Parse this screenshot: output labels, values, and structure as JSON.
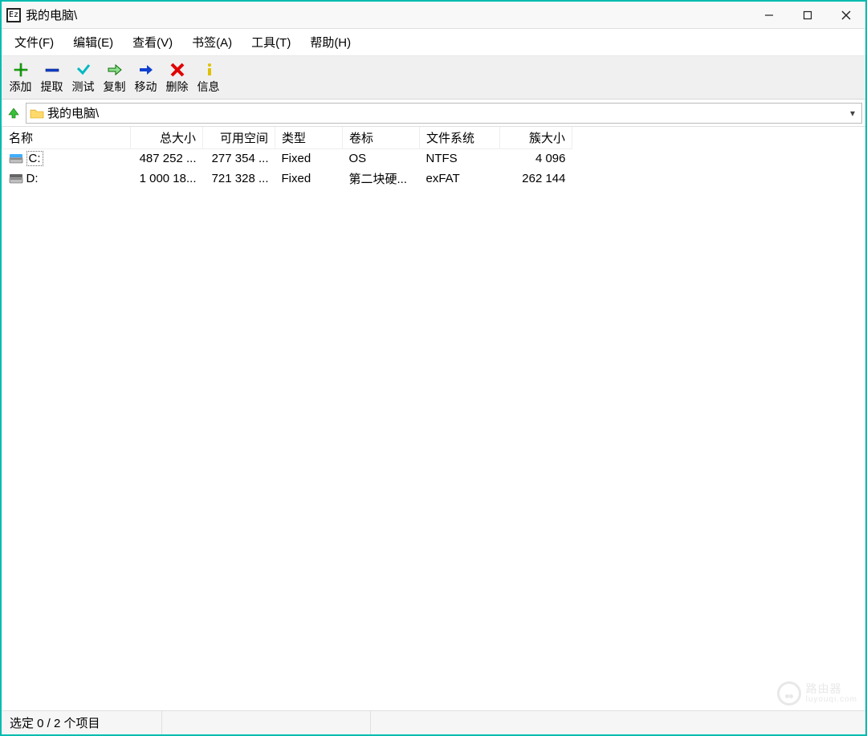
{
  "window": {
    "title": "我的电脑\\"
  },
  "menubar": {
    "file": "文件(F)",
    "edit": "编辑(E)",
    "view": "查看(V)",
    "bookmark": "书签(A)",
    "tools": "工具(T)",
    "help": "帮助(H)"
  },
  "toolbar": {
    "add": "添加",
    "extract": "提取",
    "test": "测试",
    "copy": "复制",
    "move": "移动",
    "delete": "删除",
    "info": "信息"
  },
  "pathbar": {
    "path": "我的电脑\\"
  },
  "columns": {
    "name": "名称",
    "total_size": "总大小",
    "free_space": "可用空间",
    "type": "类型",
    "label": "卷标",
    "filesystem": "文件系统",
    "cluster": "簇大小"
  },
  "rows": [
    {
      "name": "C:",
      "total_size": "487 252 ...",
      "free_space": "277 354 ...",
      "type": "Fixed",
      "label": "OS",
      "filesystem": "NTFS",
      "cluster": "4 096",
      "selected": true,
      "accent": "#2aa6ff"
    },
    {
      "name": "D:",
      "total_size": "1 000 18...",
      "free_space": "721 328 ...",
      "type": "Fixed",
      "label": "第二块硬...",
      "filesystem": "exFAT",
      "cluster": "262 144",
      "selected": false,
      "accent": "#555"
    }
  ],
  "statusbar": {
    "text": "选定 0 / 2 个项目"
  },
  "watermark": {
    "name": "路由器",
    "sub": "luyouqi.com"
  }
}
